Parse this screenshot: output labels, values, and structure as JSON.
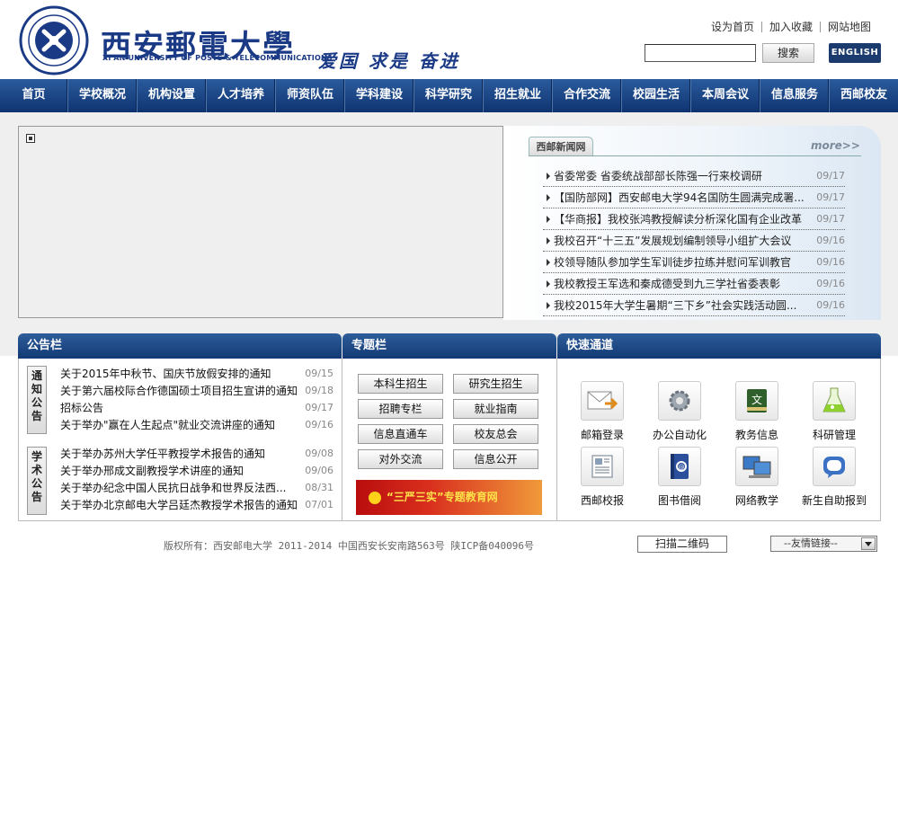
{
  "header": {
    "school_name": "西安郵電大學",
    "school_name_en": "XI'AN UNIVERSITY OF POSTS & TELECOMMUNICATIONS",
    "motto": "爱国 求是 奋进",
    "top_links": [
      "设为首页",
      "加入收藏",
      "网站地图"
    ],
    "search_button": "搜索",
    "search_value": "",
    "english_button": "ENGLISH"
  },
  "nav": [
    "首页",
    "学校概况",
    "机构设置",
    "人才培养",
    "师资队伍",
    "学科建设",
    "科学研究",
    "招生就业",
    "合作交流",
    "校园生活",
    "本周会议",
    "信息服务",
    "西邮校友"
  ],
  "news": {
    "tab": "西邮新闻网",
    "more": "more>>",
    "items": [
      {
        "title": "省委常委 省委统战部部长陈强一行来校调研",
        "date": "09/17"
      },
      {
        "title": "【国防部网】西安邮电大学94名国防生圆满完成署...",
        "date": "09/17"
      },
      {
        "title": "【华商报】我校张鸿教授解读分析深化国有企业改革",
        "date": "09/17"
      },
      {
        "title": "我校召开“十三五”发展规划编制领导小组扩大会议",
        "date": "09/16"
      },
      {
        "title": "校领导随队参加学生军训徒步拉练并慰问军训教官",
        "date": "09/16"
      },
      {
        "title": "我校教授王军选和秦成德受到九三学社省委表彰",
        "date": "09/16"
      },
      {
        "title": "我校2015年大学生暑期“三下乡”社会实践活动圆...",
        "date": "09/16"
      }
    ]
  },
  "announcements": {
    "title": "公告栏",
    "notice_label": "通知公告",
    "notices": [
      {
        "title": "关于2015年中秋节、国庆节放假安排的通知",
        "date": "09/15"
      },
      {
        "title": "关于第六届校际合作德国硕士项目招生宣讲的通知",
        "date": "09/18"
      },
      {
        "title": "招标公告",
        "date": "09/17"
      },
      {
        "title": "关于举办\"赢在人生起点\"就业交流讲座的通知",
        "date": "09/16"
      }
    ],
    "academic_label": "学术公告",
    "academic": [
      {
        "title": "关于举办苏州大学任平教授学术报告的通知",
        "date": "09/08"
      },
      {
        "title": "关于举办邢成文副教授学术讲座的通知",
        "date": "09/06"
      },
      {
        "title": "关于举办纪念中国人民抗日战争和世界反法西...",
        "date": "08/31"
      },
      {
        "title": "关于举办北京邮电大学吕廷杰教授学术报告的通知",
        "date": "07/01"
      }
    ]
  },
  "topics": {
    "title": "专题栏",
    "buttons": [
      "本科生招生",
      "研究生招生",
      "招聘专栏",
      "就业指南",
      "信息直通车",
      "校友总会",
      "对外交流",
      "信息公开"
    ],
    "banner": "“三严三实”专题教育网"
  },
  "quick": {
    "title": "快速通道",
    "items": [
      {
        "label": "邮箱登录",
        "icon": "envelope-icon"
      },
      {
        "label": "办公自动化",
        "icon": "gear-icon"
      },
      {
        "label": "教务信息",
        "icon": "book-icon"
      },
      {
        "label": "科研管理",
        "icon": "flask-icon"
      },
      {
        "label": "西邮校报",
        "icon": "newspaper-icon"
      },
      {
        "label": "图书借阅",
        "icon": "address-book-icon"
      },
      {
        "label": "网络教学",
        "icon": "computer-icon"
      },
      {
        "label": "新生自助报到",
        "icon": "chat-bubble-icon"
      }
    ]
  },
  "footer": {
    "copyright": "版权所有：西安邮电大学 2011-2014 中国西安长安南路563号 陕ICP备040096号",
    "qr_button": "扫描二维码",
    "friend_links": "--友情链接--"
  }
}
